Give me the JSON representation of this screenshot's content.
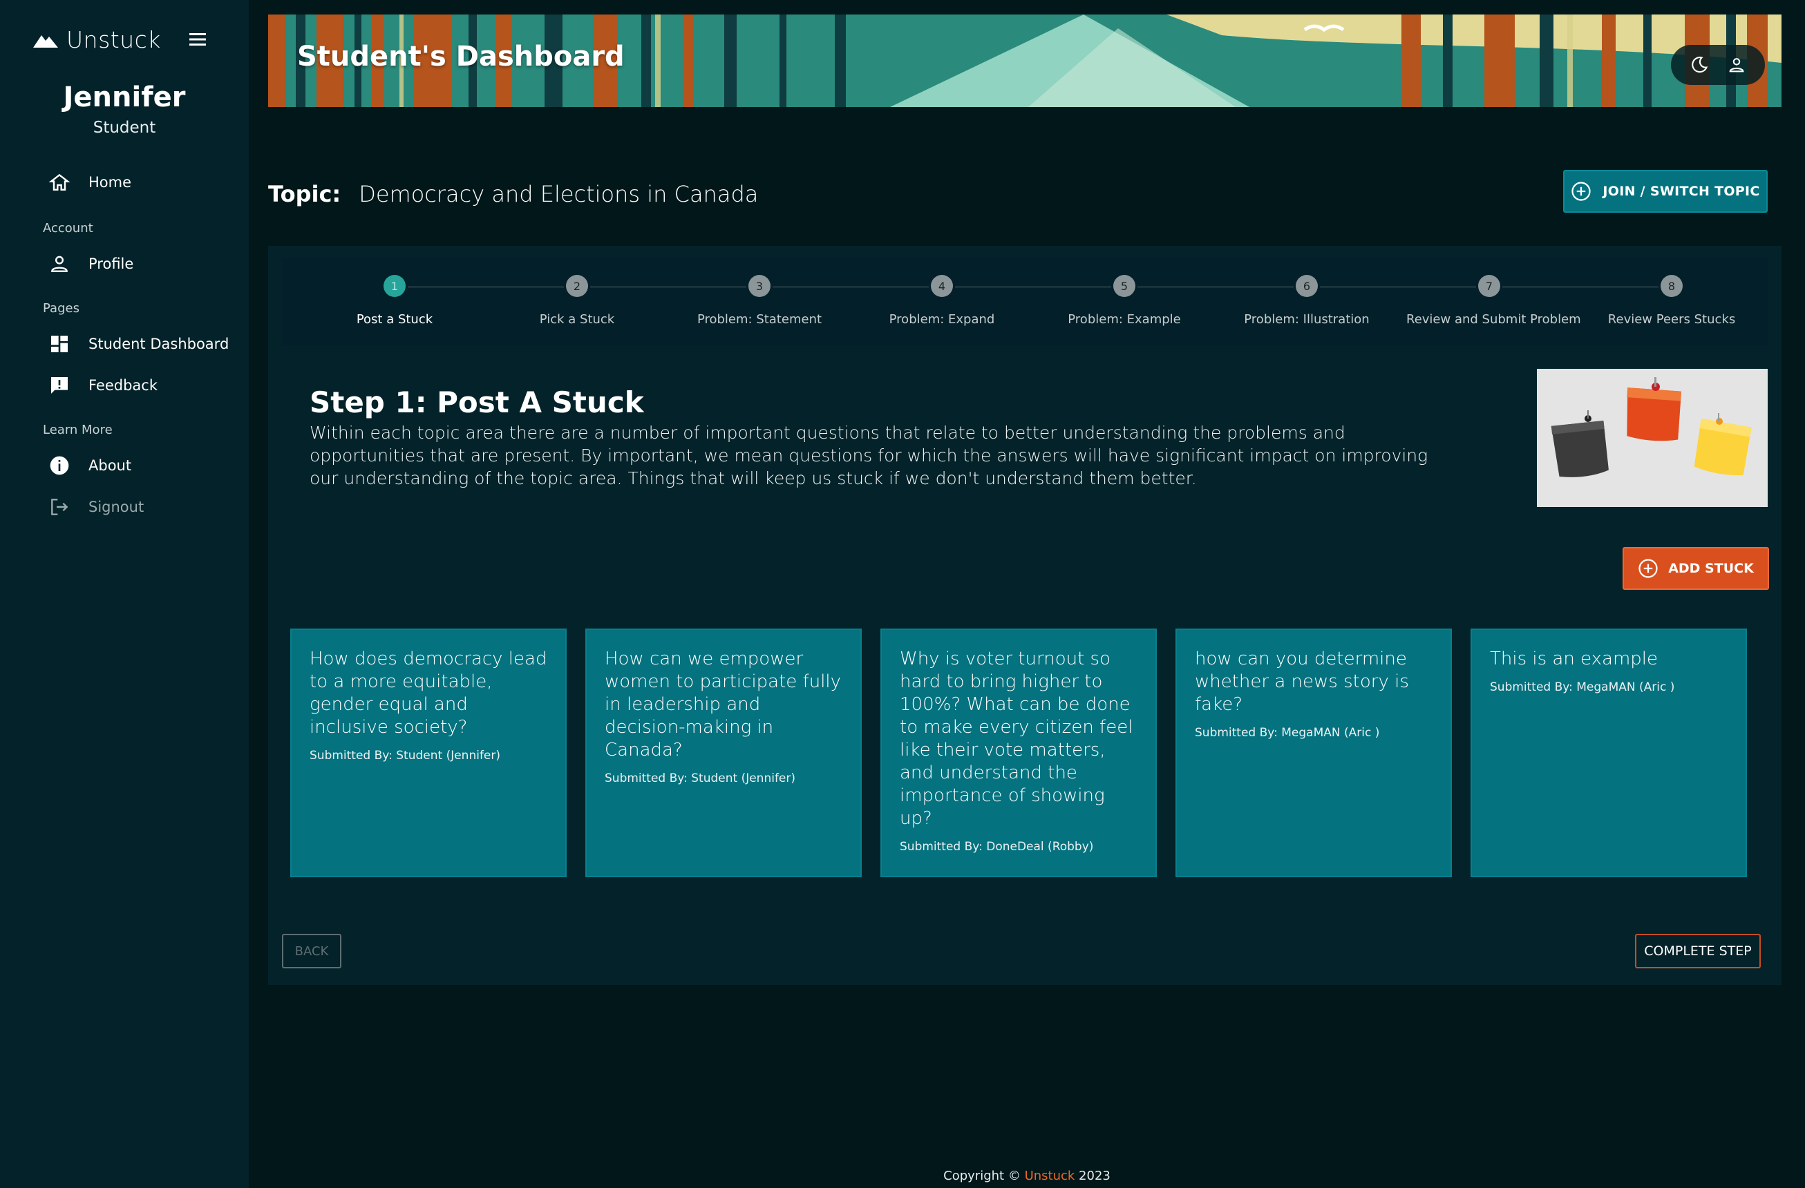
{
  "sidebar": {
    "brand": "Unstuck",
    "user_name": "Jennifer",
    "user_role": "Student",
    "items": [
      {
        "label": "Home",
        "icon": "home-icon"
      },
      {
        "label": "Profile",
        "icon": "person-icon"
      },
      {
        "label": "Student Dashboard",
        "icon": "dashboard-icon"
      },
      {
        "label": "Feedback",
        "icon": "feedback-icon"
      },
      {
        "label": "About",
        "icon": "info-icon"
      },
      {
        "label": "Signout",
        "icon": "signout-icon"
      }
    ],
    "sections": {
      "account": "Account",
      "pages": "Pages",
      "learn_more": "Learn More"
    }
  },
  "header": {
    "title": "Student's Dashboard",
    "icons": [
      "moon-icon",
      "user-icon"
    ]
  },
  "topic": {
    "label": "Topic:",
    "value": "Democracy and Elections in Canada",
    "join_label": "JOIN / SWITCH TOPIC"
  },
  "stepper": {
    "active_step": 1,
    "steps": [
      {
        "number": "1",
        "label": "Post a Stuck"
      },
      {
        "number": "2",
        "label": "Pick a Stuck"
      },
      {
        "number": "3",
        "label": "Problem: Statement"
      },
      {
        "number": "4",
        "label": "Problem: Expand"
      },
      {
        "number": "5",
        "label": "Problem: Example"
      },
      {
        "number": "6",
        "label": "Problem: Illustration"
      },
      {
        "number": "7",
        "label": "Review and Submit Problem"
      },
      {
        "number": "8",
        "label": "Review Peers Stucks"
      }
    ]
  },
  "step": {
    "title": "Step 1: Post A Stuck",
    "description": "Within each topic area there are a number of important questions that relate to better understanding the problems and opportunities that are present. By important, we mean questions for which the answers will have significant impact on improving our understanding of the topic area. Things that will keep us stuck if we don't understand them better.",
    "add_label": "ADD STUCK"
  },
  "stucks": [
    {
      "question": "How does democracy lead to a more equitable, gender equal and inclusive society?",
      "submitted_by": "Submitted By: Student (Jennifer)"
    },
    {
      "question": "How can we empower women to participate fully in leadership and decision-making in Canada?",
      "submitted_by": "Submitted By: Student (Jennifer)"
    },
    {
      "question": "Why is voter turnout so hard to bring higher to 100%? What can be done to make every citizen feel like their vote matters, and understand the importance of showing up?",
      "submitted_by": "Submitted By: DoneDeal (Robby)"
    },
    {
      "question": "how can you determine whether a news story is fake?",
      "submitted_by": "Submitted By: MegaMAN (Aric )"
    },
    {
      "question": "This is an example",
      "submitted_by": "Submitted By: MegaMAN (Aric )"
    }
  ],
  "actions": {
    "back_label": "BACK",
    "complete_label": "COMPLETE STEP"
  },
  "footer": {
    "prefix": "Copyright ©",
    "brand": "Unstuck",
    "year": "2023"
  },
  "colors": {
    "accent": "#05727f",
    "orange": "#d9501e",
    "active_step": "#27a59a",
    "background": "#021719"
  }
}
